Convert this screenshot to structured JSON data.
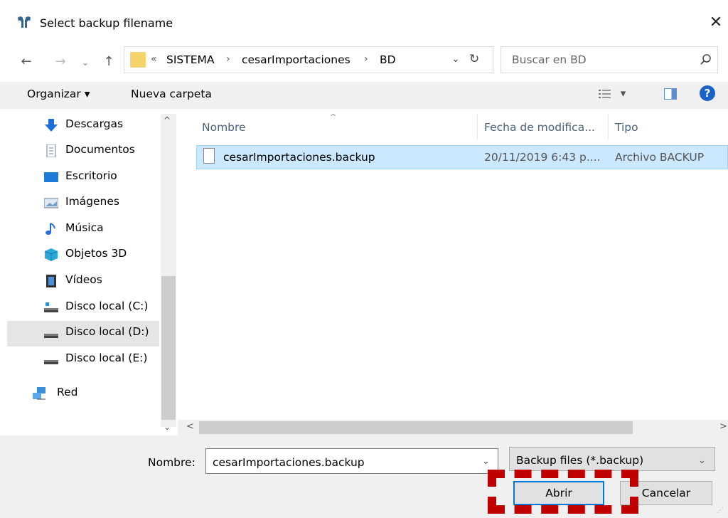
{
  "window": {
    "title": "Select backup filename",
    "close_label": "✕"
  },
  "nav": {
    "back": "←",
    "forward": "→",
    "recent": "⌄",
    "up": "↑",
    "refresh": "↻",
    "dropdown": "⌄"
  },
  "address": {
    "overflow": "«",
    "separator": "›",
    "breadcrumbs": [
      "SISTEMA",
      "cesarImportaciones",
      "BD"
    ]
  },
  "search": {
    "placeholder": "Buscar en BD"
  },
  "toolbar": {
    "organize_label": "Organizar ▾",
    "new_folder_label": "Nueva carpeta",
    "view_label": "▾",
    "help_label": "?"
  },
  "sidebar": {
    "items": [
      {
        "label": "Descargas",
        "icon": "download-icon"
      },
      {
        "label": "Documentos",
        "icon": "document-icon"
      },
      {
        "label": "Escritorio",
        "icon": "desktop-icon"
      },
      {
        "label": "Imágenes",
        "icon": "image-icon"
      },
      {
        "label": "Música",
        "icon": "music-icon"
      },
      {
        "label": "Objetos 3D",
        "icon": "cube-icon"
      },
      {
        "label": "Vídeos",
        "icon": "video-icon"
      },
      {
        "label": "Disco local (C:)",
        "icon": "drive-c-icon"
      },
      {
        "label": "Disco local (D:)",
        "icon": "drive-icon",
        "selected": true
      },
      {
        "label": "Disco local (E:)",
        "icon": "drive-icon"
      },
      {
        "label": "Red",
        "icon": "network-icon"
      }
    ],
    "scroll_up": "^",
    "scroll_down": "⌄"
  },
  "file_list": {
    "columns": [
      "Nombre",
      "Fecha de modifica...",
      "Tipo"
    ],
    "sort_indicator": "^",
    "rows": [
      {
        "name": "cesarImportaciones.backup",
        "date": "20/11/2019 6:43 p....",
        "type": "Archivo BACKUP",
        "selected": true
      }
    ],
    "scroll_left": "<",
    "scroll_right": ">"
  },
  "footer": {
    "name_label": "Nombre:",
    "name_value": "cesarImportaciones.backup",
    "filter_value": "Backup files (*.backup)",
    "dropdown": "⌄",
    "open_label": "Abrir",
    "cancel_label": "Cancelar"
  },
  "colors": {
    "selection": "#cce8ff",
    "accent": "#0078d7",
    "highlight": "#c00000"
  }
}
